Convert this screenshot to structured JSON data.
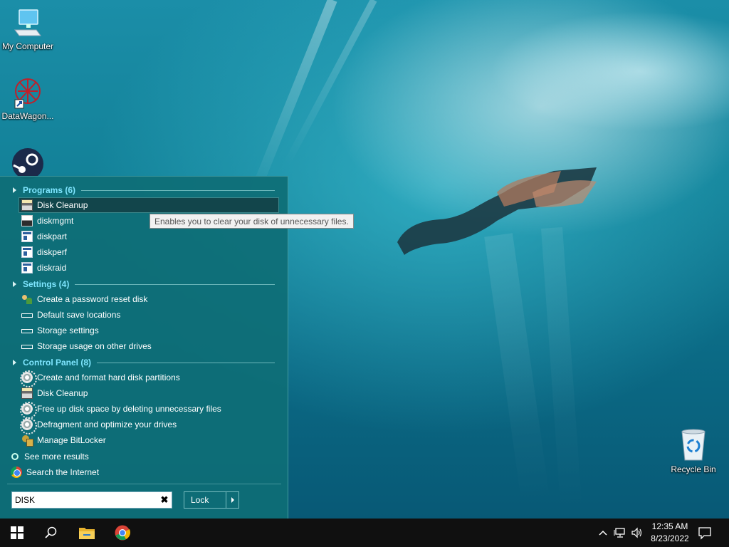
{
  "desktop": {
    "icons": [
      {
        "label": "My Computer",
        "icon": "computer-icon"
      },
      {
        "label": "DataWagon...",
        "icon": "datawagon-icon"
      },
      {
        "label": "",
        "icon": "steam-icon"
      },
      {
        "label": "Recycle Bin",
        "icon": "recycle-bin-icon"
      }
    ]
  },
  "start_menu": {
    "programs": {
      "header": "Programs (6)",
      "items": [
        {
          "label": "Disk Cleanup",
          "icon": "disk-cleanup-icon",
          "selected": true
        },
        {
          "label": "diskmgmt",
          "icon": "disk-management-icon"
        },
        {
          "label": "diskpart",
          "icon": "console-window-icon"
        },
        {
          "label": "diskperf",
          "icon": "console-window-icon"
        },
        {
          "label": "diskraid",
          "icon": "console-window-icon"
        }
      ]
    },
    "settings": {
      "header": "Settings (4)",
      "items": [
        {
          "label": "Create a password reset disk",
          "icon": "users-icon"
        },
        {
          "label": "Default save locations",
          "icon": "drive-bar-icon"
        },
        {
          "label": "Storage settings",
          "icon": "drive-bar-icon"
        },
        {
          "label": "Storage usage on other drives",
          "icon": "drive-bar-icon"
        }
      ]
    },
    "control_panel": {
      "header": "Control Panel (8)",
      "items": [
        {
          "label": "Create and format hard disk partitions",
          "icon": "gear-icon"
        },
        {
          "label": "Disk Cleanup",
          "icon": "disk-cleanup-icon"
        },
        {
          "label": "Free up disk space by deleting unnecessary files",
          "icon": "gear-icon"
        },
        {
          "label": "Defragment and optimize your drives",
          "icon": "gear-icon"
        },
        {
          "label": "Manage BitLocker",
          "icon": "bitlocker-icon"
        }
      ]
    },
    "see_more": "See more results",
    "search_internet": "Search the Internet",
    "search_value": "DISK",
    "lock_label": "Lock",
    "tooltip": "Enables you to clear your disk of unnecessary files."
  },
  "taskbar": {
    "time": "12:35 AM",
    "date": "8/23/2022"
  },
  "colors": {
    "menu_bg": "#0e6e76",
    "section_header": "#7fe6ff",
    "taskbar_bg": "#101010"
  }
}
